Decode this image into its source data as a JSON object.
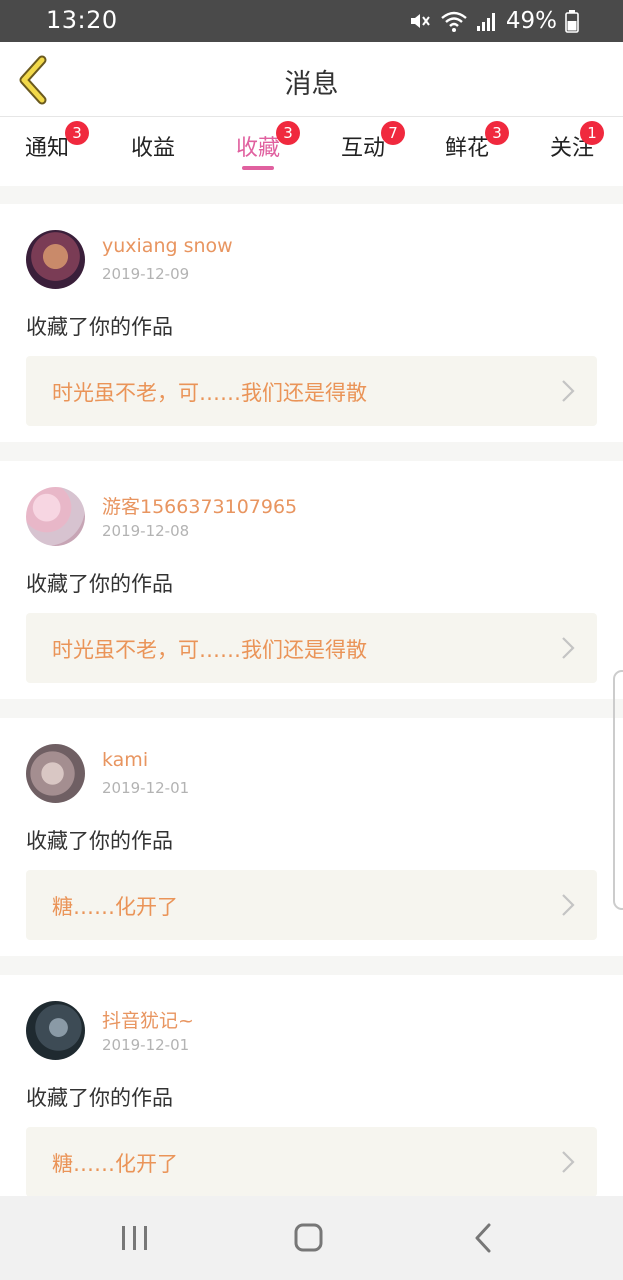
{
  "status_bar": {
    "time": "13:20",
    "battery": "49%"
  },
  "header": {
    "title": "消息"
  },
  "tabs": [
    {
      "label": "通知",
      "badge": "3"
    },
    {
      "label": "收益",
      "badge": ""
    },
    {
      "label": "收藏",
      "badge": "3",
      "active": true
    },
    {
      "label": "互动",
      "badge": "7"
    },
    {
      "label": "鲜花",
      "badge": "3"
    },
    {
      "label": "关注",
      "badge": "1"
    }
  ],
  "items": [
    {
      "name": "yuxiang snow",
      "date": "2019-12-09",
      "action": "收藏了你的作品",
      "work": "时光虽不老，可……我们还是得散"
    },
    {
      "name": "游客1566373107965",
      "date": "2019-12-08",
      "action": "收藏了你的作品",
      "work": "时光虽不老，可……我们还是得散"
    },
    {
      "name": "kami",
      "date": "2019-12-01",
      "action": "收藏了你的作品",
      "work": "糖……化开了"
    },
    {
      "name": "抖音犹记~",
      "date": "2019-12-01",
      "action": "收藏了你的作品",
      "work": "糖……化开了"
    }
  ],
  "colors": {
    "accent": "#e0609f",
    "name": "#e89560",
    "badge": "#f0293e",
    "back_arrow": "#f2d94a"
  },
  "icons": {
    "back": "back-arrow-icon",
    "chevron": "chevron-right-icon",
    "nav": [
      "recent-apps-icon",
      "home-icon",
      "nav-back-icon"
    ]
  }
}
